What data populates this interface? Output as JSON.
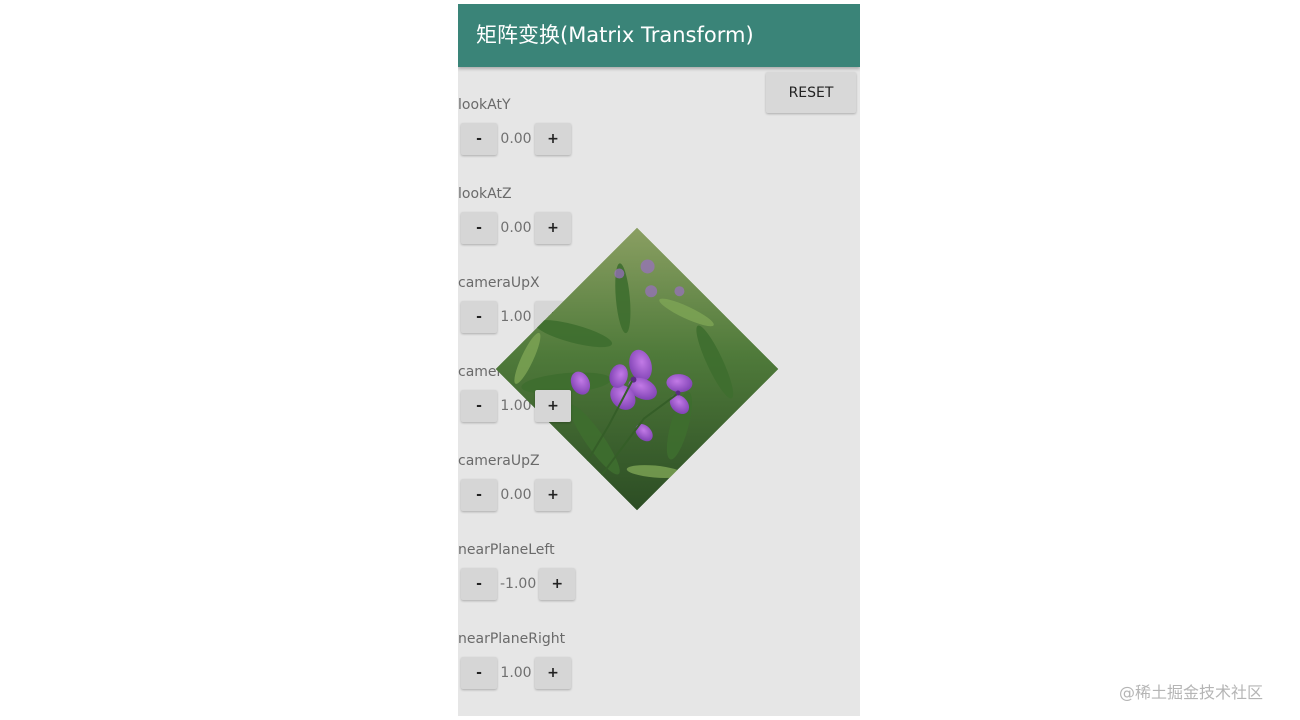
{
  "appbar": {
    "title": "矩阵变换(Matrix Transform)"
  },
  "reset_label": "RESET",
  "params": [
    {
      "label": "lookAtY",
      "minus": "-",
      "value": "0.00",
      "plus": "+"
    },
    {
      "label": "lookAtZ",
      "minus": "-",
      "value": "0.00",
      "plus": "+"
    },
    {
      "label": "cameraUpX",
      "minus": "-",
      "value": "1.00",
      "plus": "+"
    },
    {
      "label": "cameraUpY",
      "minus": "-",
      "value": "1.00",
      "plus": "+"
    },
    {
      "label": "cameraUpZ",
      "minus": "-",
      "value": "0.00",
      "plus": "+"
    },
    {
      "label": "nearPlaneLeft",
      "minus": "-",
      "value": "-1.00",
      "plus": "+"
    },
    {
      "label": "nearPlaneRight",
      "minus": "-",
      "value": "1.00",
      "plus": "+"
    }
  ],
  "image": {
    "subject": "purple-flowers-photo"
  },
  "watermark": "@稀土掘金技术社区",
  "colors": {
    "appbar": "#3a8478",
    "panel": "#e6e6e6",
    "button": "#d6d6d6"
  }
}
